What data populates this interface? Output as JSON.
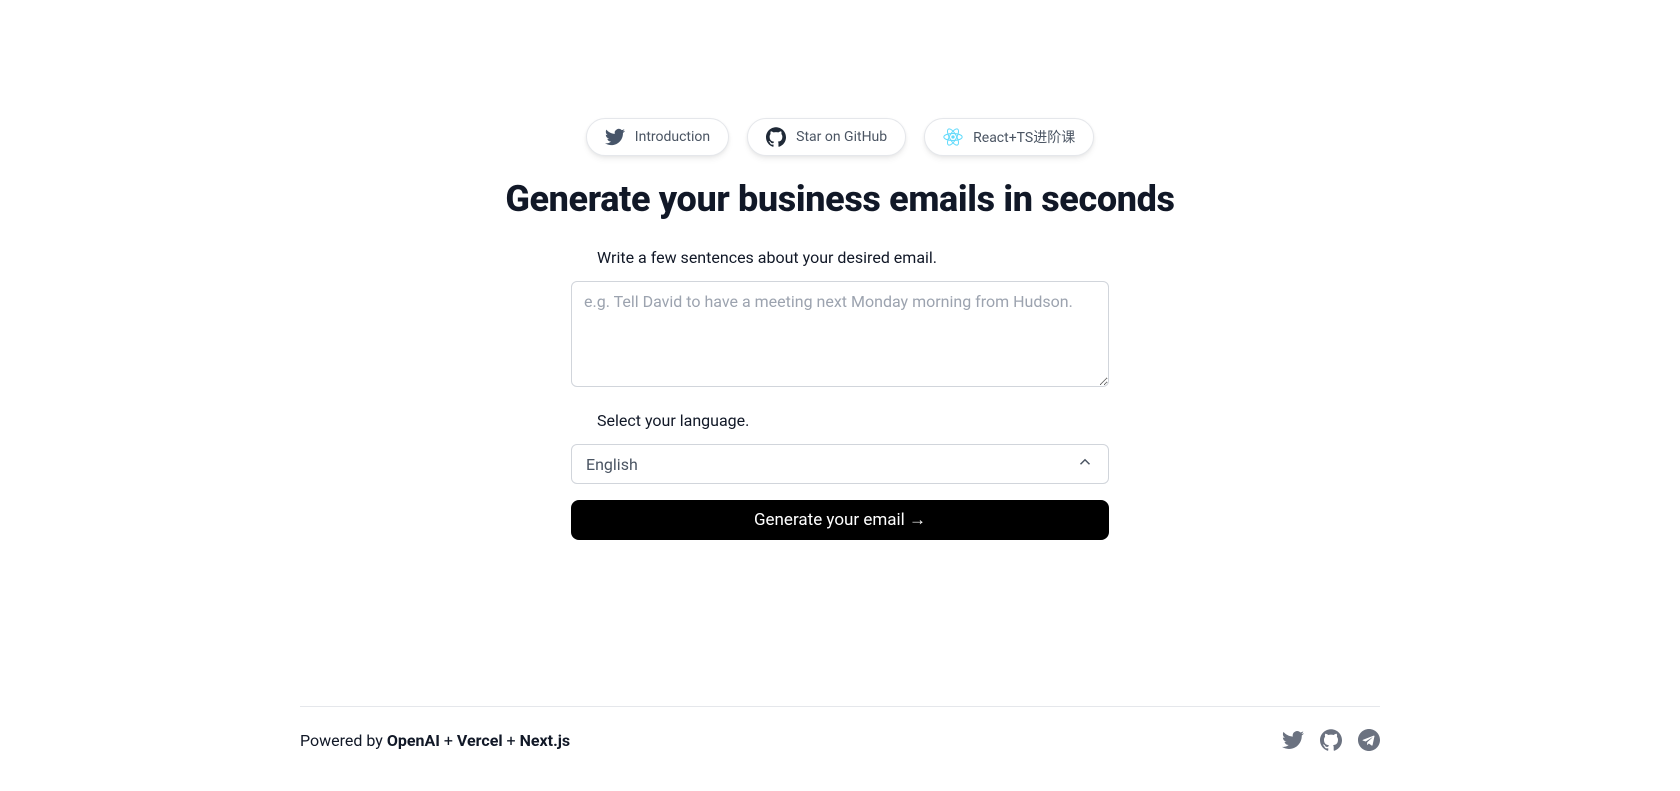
{
  "pills": {
    "introduction": "Introduction",
    "github": "Star on GitHub",
    "react": "React+TS进阶课"
  },
  "title": "Generate your business emails in seconds",
  "form": {
    "step1_label": "Write a few sentences about your desired email.",
    "textarea_placeholder": "e.g. Tell David to have a meeting next Monday morning from Hudson.",
    "step2_label": "Select your language.",
    "language_selected": "English",
    "generate_button": "Generate your email →"
  },
  "footer": {
    "prefix": "Powered by ",
    "openai": "OpenAI",
    "plus": " + ",
    "vercel": "Vercel",
    "nextjs": "Next.js"
  }
}
